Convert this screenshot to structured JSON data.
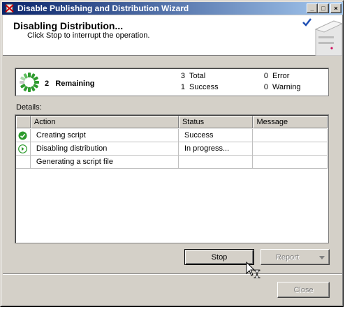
{
  "window": {
    "title": "Disable Publishing and Distribution Wizard"
  },
  "titlebar_buttons": {
    "minimize": "_",
    "maximize": "□",
    "close": "×"
  },
  "header": {
    "title": "Disabling Distribution...",
    "subtitle": "Click Stop to interrupt the operation."
  },
  "summary": {
    "remaining_count": "2",
    "remaining_label": "Remaining",
    "total_count": "3",
    "total_label": "Total",
    "success_count": "1",
    "success_label": "Success",
    "error_count": "0",
    "error_label": "Error",
    "warning_count": "0",
    "warning_label": "Warning"
  },
  "details": {
    "label": "Details:",
    "columns": [
      "Action",
      "Status",
      "Message"
    ],
    "rows": [
      {
        "icon": "success-check-icon",
        "action": "Creating script",
        "status": "Success",
        "message": ""
      },
      {
        "icon": "in-progress-arrow-icon",
        "action": "Disabling distribution",
        "status": "In progress...",
        "message": ""
      },
      {
        "icon": "",
        "action": "Generating a script file",
        "status": "",
        "message": ""
      }
    ]
  },
  "buttons": {
    "stop": "Stop",
    "report": "Report",
    "close": "Close"
  },
  "colors": {
    "title_gradient_start": "#0a246a",
    "title_gradient_end": "#a6caf0",
    "success_green": "#2e9b2e",
    "face": "#d4d0c8"
  }
}
